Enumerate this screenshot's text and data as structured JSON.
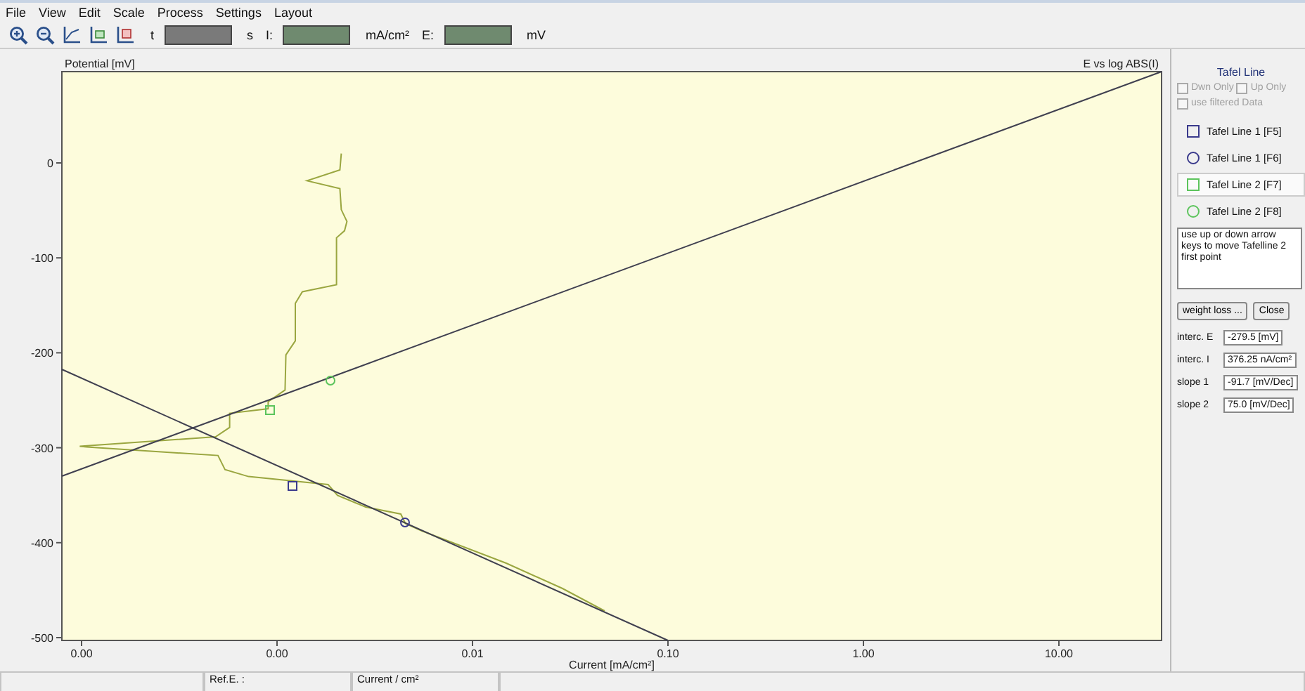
{
  "menu": [
    "File",
    "View",
    "Edit",
    "Scale",
    "Process",
    "Settings",
    "Layout"
  ],
  "toolbar": {
    "tools": [
      {
        "kind": "zoom-in"
      },
      {
        "kind": "zoom-out"
      },
      {
        "kind": "axis"
      },
      {
        "kind": "axis-lin"
      },
      {
        "kind": "axis-log"
      }
    ],
    "fields": [
      {
        "label": "t",
        "kind": "plain",
        "unit": "s"
      },
      {
        "label": "I:",
        "kind": "green",
        "unit": "mA/cm²"
      },
      {
        "label": "E:",
        "kind": "green",
        "unit": "mV"
      }
    ]
  },
  "chart": {
    "title_left": "Potential [mV]",
    "title_right": "E vs log ABS(I)",
    "xlabel": "Current [mA/cm²]",
    "x_ticks": [
      "0.00",
      "0.00",
      "0.01",
      "0.10",
      "1.00",
      "10.00"
    ],
    "y_ticks": [
      "0",
      "-100",
      "-200",
      "-300",
      "-400",
      "-500"
    ]
  },
  "panel": {
    "title": "Tafel Line",
    "options": [
      {
        "label": "Dwn Only",
        "checked": false,
        "disabled": true
      },
      {
        "label": "Up Only",
        "checked": false,
        "disabled": true
      }
    ],
    "filter": {
      "label": "use filtered Data",
      "checked": false,
      "disabled": true
    },
    "lines": [
      {
        "label": "Tafel Line 1 [F5]",
        "kind": "square",
        "color": "#3a3a8c",
        "selected": false
      },
      {
        "label": "Tafel Line 1 [F6]",
        "kind": "circle",
        "color": "#3a3a8c",
        "selected": false
      },
      {
        "label": "Tafel Line 2 [F7]",
        "kind": "square",
        "color": "#5cc45c",
        "selected": true
      },
      {
        "label": "Tafel Line 2 [F8]",
        "kind": "circle",
        "color": "#5cc45c",
        "selected": false
      }
    ],
    "message": "use up or down arrow keys to move Tafelline 2 first point",
    "buttons": [
      "weight loss ...",
      "Close"
    ],
    "results": [
      {
        "label": "interc. E",
        "value": "-279.5 [mV]"
      },
      {
        "label": "interc. I",
        "value": "376.25 nA/cm²"
      },
      {
        "label": "slope 1",
        "value": "-91.7 [mV/Dec]"
      },
      {
        "label": "slope 2",
        "value": "75.0 [mV/Dec]"
      }
    ]
  },
  "status_bar": [
    "Ref.E. :",
    "Current / cm²"
  ]
}
